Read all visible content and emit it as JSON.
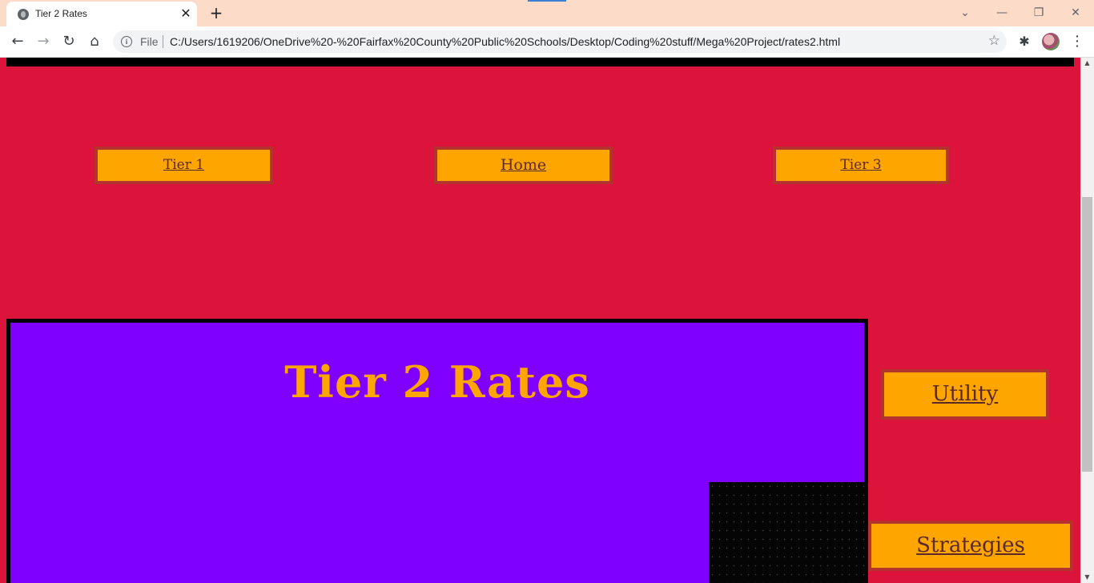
{
  "browser": {
    "tab_title": "Tier 2 Rates",
    "tab_close": "✕",
    "new_tab": "+",
    "window_controls": {
      "dropdown": "⌄",
      "minimize": "—",
      "restore": "❐",
      "close": "✕"
    },
    "nav": {
      "back": "←",
      "forward": "→",
      "reload": "↻",
      "home": "⌂"
    },
    "omnibox": {
      "info_glyph": "i",
      "scheme_label": "File",
      "url": "C:/Users/1619206/OneDrive%20-%20Fairfax%20County%20Public%20Schools/Desktop/Coding%20stuff/Mega%20Project/rates2.html"
    },
    "icons": {
      "bookmark": "☆",
      "extensions": "✱",
      "menu": "⋮"
    }
  },
  "page": {
    "nav_links": {
      "tier1": "Tier 1",
      "home": "Home",
      "tier3": "Tier 3"
    },
    "heading": "Tier 2 Rates",
    "side_links": {
      "utility": "Utility",
      "strategies": "Strategies"
    },
    "colors": {
      "background": "#dc143c",
      "button": "#ffa500",
      "button_border": "#b5332e",
      "panel": "#7f00ff",
      "heading": "#ffa500"
    }
  },
  "scrollbar": {
    "up": "▲",
    "down": "▼"
  }
}
